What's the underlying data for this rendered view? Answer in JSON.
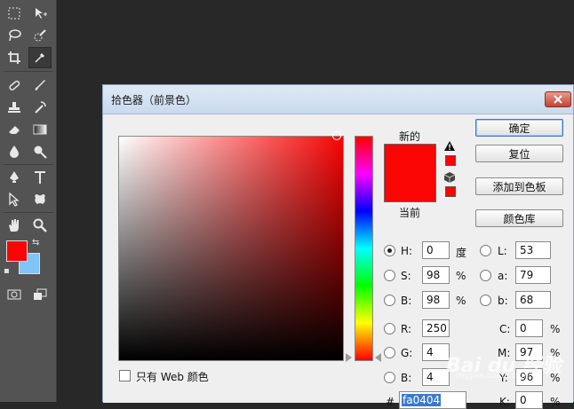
{
  "dialog": {
    "title": "拾色器（前景色）",
    "new_label": "新的",
    "current_label": "当前",
    "buttons": {
      "ok": "确定",
      "reset": "复位",
      "add_to_swatches": "添加到色板",
      "color_libraries": "颜色库"
    },
    "fields": {
      "H": {
        "label": "H:",
        "value": "0",
        "unit": "度"
      },
      "S": {
        "label": "S:",
        "value": "98",
        "unit": "%"
      },
      "B": {
        "label": "B:",
        "value": "98",
        "unit": "%"
      },
      "R": {
        "label": "R:",
        "value": "250"
      },
      "G": {
        "label": "G:",
        "value": "4"
      },
      "Bb": {
        "label": "B:",
        "value": "4"
      },
      "L": {
        "label": "L:",
        "value": "53"
      },
      "a": {
        "label": "a:",
        "value": "79"
      },
      "b": {
        "label": "b:",
        "value": "68"
      },
      "C": {
        "label": "C:",
        "value": "0",
        "unit": "%"
      },
      "M": {
        "label": "M:",
        "value": "97",
        "unit": "%"
      },
      "Y": {
        "label": "Y:",
        "value": "96",
        "unit": "%"
      },
      "K": {
        "label": "K:",
        "value": "0",
        "unit": "%"
      },
      "hex": {
        "label": "#",
        "value": "fa0404"
      }
    },
    "web_only_label": "只有 Web 颜色",
    "selected_channel": "H",
    "new_color": "#fa0404",
    "current_color": "#fa0404"
  },
  "toolbar": {
    "foreground_color": "#fa0404",
    "background_color": "#80c4f8"
  },
  "watermark": {
    "text": "Bai du 经验",
    "sub": "jingyan.baidu.com"
  }
}
